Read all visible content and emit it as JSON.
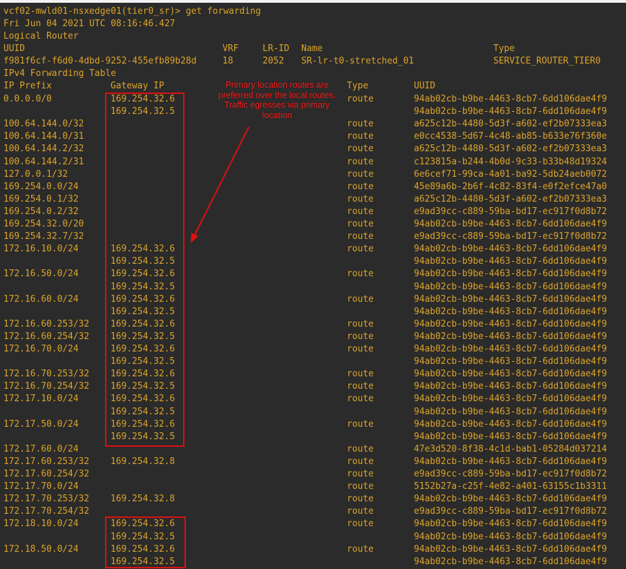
{
  "terminal": {
    "prompt": "vcf02-mwld01-nsxedge01(tier0_sr)> get forwarding",
    "timestamp": "Fri Jun 04 2021 UTC 08:16:46.427",
    "section_logical_router": "Logical Router",
    "lr_headers": {
      "uuid": "UUID",
      "vrf": "VRF",
      "lr_id": "LR-ID",
      "name": "Name",
      "type": "Type"
    },
    "lr_row": {
      "uuid": "f981f6cf-f6d0-4dbd-9252-455efb89b28d",
      "vrf": "18",
      "lr_id": "2052",
      "name": "SR-lr-t0-stretched_01",
      "type": "SERVICE_ROUTER_TIER0"
    },
    "section_table": "IPv4 Forwarding Table",
    "table_headers": {
      "prefix": "IP Prefix",
      "gateway": "Gateway IP",
      "type": "Type",
      "uuid": "UUID"
    },
    "rows": [
      [
        "0.0.0.0/0",
        "169.254.32.6",
        "route",
        "94ab02cb-b9be-4463-8cb7-6dd106dae4f9"
      ],
      [
        "",
        "169.254.32.5",
        "",
        "94ab02cb-b9be-4463-8cb7-6dd106dae4f9"
      ],
      [
        "100.64.144.0/32",
        "",
        "route",
        "a625c12b-4480-5d3f-a602-ef2b07333ea3"
      ],
      [
        "100.64.144.0/31",
        "",
        "route",
        "e0cc4538-5d67-4c48-ab85-b633e76f360e"
      ],
      [
        "100.64.144.2/32",
        "",
        "route",
        "a625c12b-4480-5d3f-a602-ef2b07333ea3"
      ],
      [
        "100.64.144.2/31",
        "",
        "route",
        "c123815a-b244-4b0d-9c33-b33b48d19324"
      ],
      [
        "127.0.0.1/32",
        "",
        "route",
        "6e6cef71-99ca-4a01-ba92-5db24aeb0072"
      ],
      [
        "169.254.0.0/24",
        "",
        "route",
        "45e89a6b-2b6f-4c82-83f4-e0f2efce47a0"
      ],
      [
        "169.254.0.1/32",
        "",
        "route",
        "a625c12b-4480-5d3f-a602-ef2b07333ea3"
      ],
      [
        "169.254.0.2/32",
        "",
        "route",
        "e9ad39cc-c889-59ba-bd17-ec917f0d8b72"
      ],
      [
        "169.254.32.0/20",
        "",
        "route",
        "94ab02cb-b9be-4463-8cb7-6dd106dae4f9"
      ],
      [
        "169.254.32.7/32",
        "",
        "route",
        "e9ad39cc-c889-59ba-bd17-ec917f0d8b72"
      ],
      [
        "172.16.10.0/24",
        "169.254.32.6",
        "route",
        "94ab02cb-b9be-4463-8cb7-6dd106dae4f9"
      ],
      [
        "",
        "169.254.32.5",
        "",
        "94ab02cb-b9be-4463-8cb7-6dd106dae4f9"
      ],
      [
        "172.16.50.0/24",
        "169.254.32.6",
        "route",
        "94ab02cb-b9be-4463-8cb7-6dd106dae4f9"
      ],
      [
        "",
        "169.254.32.5",
        "",
        "94ab02cb-b9be-4463-8cb7-6dd106dae4f9"
      ],
      [
        "172.16.60.0/24",
        "169.254.32.6",
        "route",
        "94ab02cb-b9be-4463-8cb7-6dd106dae4f9"
      ],
      [
        "",
        "169.254.32.5",
        "",
        "94ab02cb-b9be-4463-8cb7-6dd106dae4f9"
      ],
      [
        "172.16.60.253/32",
        "169.254.32.6",
        "route",
        "94ab02cb-b9be-4463-8cb7-6dd106dae4f9"
      ],
      [
        "172.16.60.254/32",
        "169.254.32.5",
        "route",
        "94ab02cb-b9be-4463-8cb7-6dd106dae4f9"
      ],
      [
        "172.16.70.0/24",
        "169.254.32.6",
        "route",
        "94ab02cb-b9be-4463-8cb7-6dd106dae4f9"
      ],
      [
        "",
        "169.254.32.5",
        "",
        "94ab02cb-b9be-4463-8cb7-6dd106dae4f9"
      ],
      [
        "172.16.70.253/32",
        "169.254.32.6",
        "route",
        "94ab02cb-b9be-4463-8cb7-6dd106dae4f9"
      ],
      [
        "172.16.70.254/32",
        "169.254.32.5",
        "route",
        "94ab02cb-b9be-4463-8cb7-6dd106dae4f9"
      ],
      [
        "172.17.10.0/24",
        "169.254.32.6",
        "route",
        "94ab02cb-b9be-4463-8cb7-6dd106dae4f9"
      ],
      [
        "",
        "169.254.32.5",
        "",
        "94ab02cb-b9be-4463-8cb7-6dd106dae4f9"
      ],
      [
        "172.17.50.0/24",
        "169.254.32.6",
        "route",
        "94ab02cb-b9be-4463-8cb7-6dd106dae4f9"
      ],
      [
        "",
        "169.254.32.5",
        "",
        "94ab02cb-b9be-4463-8cb7-6dd106dae4f9"
      ],
      [
        "172.17.60.0/24",
        "",
        "route",
        "47e3d520-8f38-4c1d-bab1-05284d037214"
      ],
      [
        "172.17.60.253/32",
        "169.254.32.8",
        "route",
        "94ab02cb-b9be-4463-8cb7-6dd106dae4f9"
      ],
      [
        "172.17.60.254/32",
        "",
        "route",
        "e9ad39cc-c889-59ba-bd17-ec917f0d8b72"
      ],
      [
        "172.17.70.0/24",
        "",
        "route",
        "5152b27a-c25f-4e82-a401-63155c1b3311"
      ],
      [
        "172.17.70.253/32",
        "169.254.32.8",
        "route",
        "94ab02cb-b9be-4463-8cb7-6dd106dae4f9"
      ],
      [
        "172.17.70.254/32",
        "",
        "route",
        "e9ad39cc-c889-59ba-bd17-ec917f0d8b72"
      ],
      [
        "172.18.10.0/24",
        "169.254.32.6",
        "route",
        "94ab02cb-b9be-4463-8cb7-6dd106dae4f9"
      ],
      [
        "",
        "169.254.32.5",
        "",
        "94ab02cb-b9be-4463-8cb7-6dd106dae4f9"
      ],
      [
        "172.18.50.0/24",
        "169.254.32.6",
        "route",
        "94ab02cb-b9be-4463-8cb7-6dd106dae4f9"
      ],
      [
        "",
        "169.254.32.5",
        "",
        "94ab02cb-b9be-4463-8cb7-6dd106dae4f9"
      ]
    ]
  },
  "annotation": {
    "text": "Primary location routes are preferred over the local routes. Traffic egresses via primary location",
    "color": "#e01010"
  },
  "colors": {
    "background": "#2b2b2b",
    "text": "#dca42a"
  }
}
